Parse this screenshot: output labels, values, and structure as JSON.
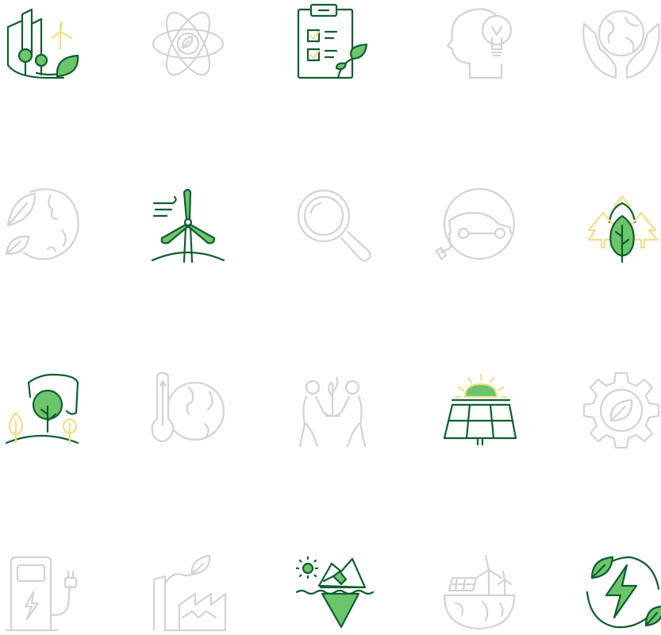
{
  "palette": {
    "dark_green": "#0f5e2e",
    "leaf_green": "#6cc56a",
    "pale_yellow": "#f1de8a",
    "muted_gray": "#d3d3d3"
  },
  "icons": [
    {
      "name": "green-city-icon",
      "state": "active"
    },
    {
      "name": "eco-atom-icon",
      "state": "muted"
    },
    {
      "name": "eco-checklist-icon",
      "state": "active"
    },
    {
      "name": "idea-head-icon",
      "state": "muted"
    },
    {
      "name": "hands-globe-icon",
      "state": "muted"
    },
    {
      "name": "leaf-globe-icon",
      "state": "muted"
    },
    {
      "name": "wind-turbine-icon",
      "state": "active"
    },
    {
      "name": "magnifier-icon",
      "state": "muted"
    },
    {
      "name": "electric-car-icon",
      "state": "muted"
    },
    {
      "name": "forest-icon",
      "state": "active"
    },
    {
      "name": "hand-tree-icon",
      "state": "active"
    },
    {
      "name": "climate-thermometer-icon",
      "state": "muted"
    },
    {
      "name": "people-planting-icon",
      "state": "muted"
    },
    {
      "name": "solar-panel-icon",
      "state": "active"
    },
    {
      "name": "eco-gear-icon",
      "state": "muted"
    },
    {
      "name": "ev-charger-icon",
      "state": "muted"
    },
    {
      "name": "factory-leaf-icon",
      "state": "muted"
    },
    {
      "name": "iceberg-icon",
      "state": "active"
    },
    {
      "name": "renewable-earth-icon",
      "state": "muted"
    },
    {
      "name": "green-energy-icon",
      "state": "active"
    }
  ]
}
